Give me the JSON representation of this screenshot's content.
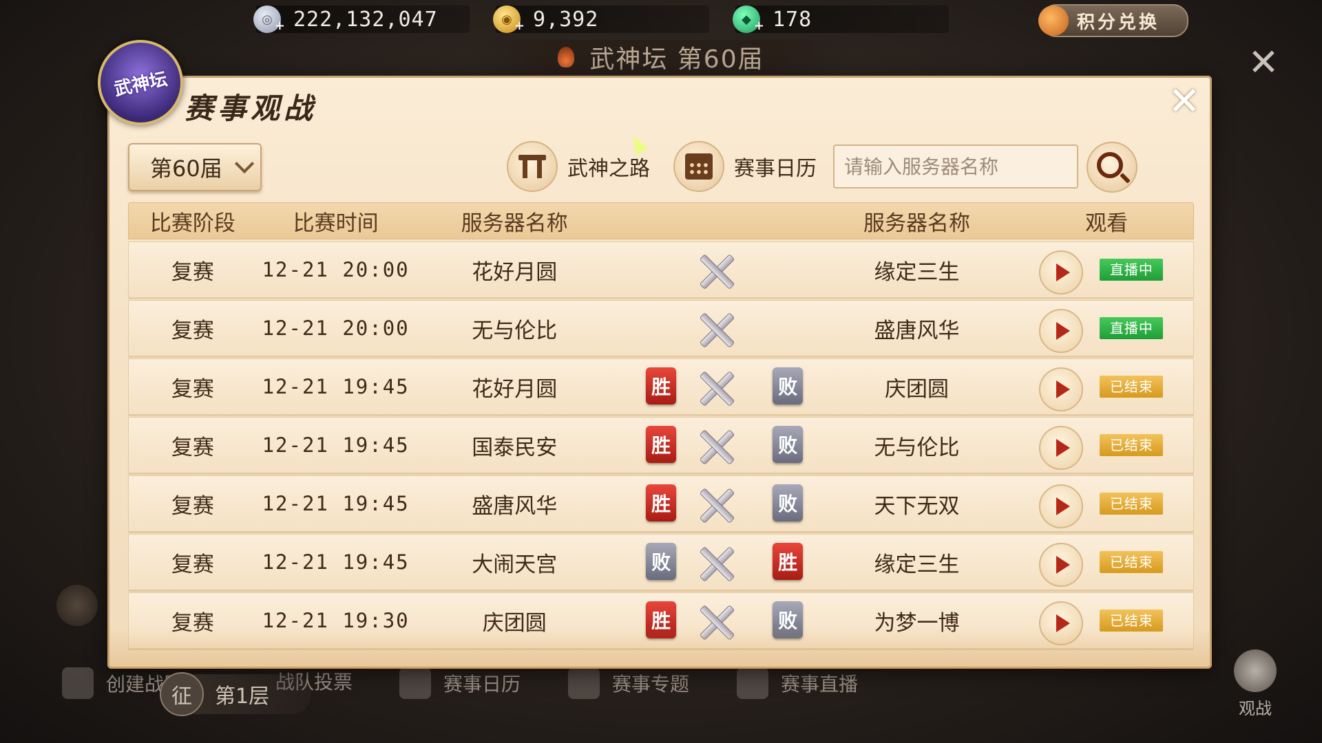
{
  "currencies": [
    {
      "icon": "silver-coin-icon",
      "value": "222,132,047"
    },
    {
      "icon": "gold-coin-icon",
      "value": "9,392"
    },
    {
      "icon": "jade-icon",
      "value": "178"
    }
  ],
  "exchange_label": "积分兑换",
  "arena_title": "武神坛 第60届",
  "emblem_text": "武神坛",
  "panel": {
    "title": "赛事观战",
    "close": "✕",
    "season_select": "第60届",
    "road_button": "武神之路",
    "calendar_button": "赛事日历",
    "search_placeholder": "请输入服务器名称"
  },
  "table": {
    "headers": {
      "stage": "比赛阶段",
      "time": "比赛时间",
      "server1": "服务器名称",
      "server2": "服务器名称",
      "watch": "观看"
    },
    "rows": [
      {
        "stage": "复赛",
        "time": "12-21 20:00",
        "server1": "花好月圆",
        "left_result": "",
        "right_result": "",
        "server2": "缘定三生",
        "status": "直播中"
      },
      {
        "stage": "复赛",
        "time": "12-21 20:00",
        "server1": "无与伦比",
        "left_result": "",
        "right_result": "",
        "server2": "盛唐风华",
        "status": "直播中"
      },
      {
        "stage": "复赛",
        "time": "12-21 19:45",
        "server1": "花好月圆",
        "left_result": "胜",
        "right_result": "败",
        "server2": "庆团圆",
        "status": "已结束"
      },
      {
        "stage": "复赛",
        "time": "12-21 19:45",
        "server1": "国泰民安",
        "left_result": "胜",
        "right_result": "败",
        "server2": "无与伦比",
        "status": "已结束"
      },
      {
        "stage": "复赛",
        "time": "12-21 19:45",
        "server1": "盛唐风华",
        "left_result": "胜",
        "right_result": "败",
        "server2": "天下无双",
        "status": "已结束"
      },
      {
        "stage": "复赛",
        "time": "12-21 19:45",
        "server1": "大闹天宫",
        "left_result": "败",
        "right_result": "胜",
        "server2": "缘定三生",
        "status": "已结束"
      },
      {
        "stage": "复赛",
        "time": "12-21 19:30",
        "server1": "庆团圆",
        "left_result": "胜",
        "right_result": "败",
        "server2": "为梦一博",
        "status": "已结束"
      }
    ]
  },
  "bottom_bar": {
    "create": "创建战队",
    "vote": "战队投票",
    "calendar": "赛事日历",
    "topic": "赛事专题",
    "live": "赛事直播",
    "floor": "第1层",
    "floor_badge": "征",
    "watch": "观战"
  },
  "colors": {
    "live_status": "#2fb447",
    "ended_status": "#e0a833",
    "win_badge": "#c8281e",
    "lose_badge": "#8a8c9c"
  }
}
